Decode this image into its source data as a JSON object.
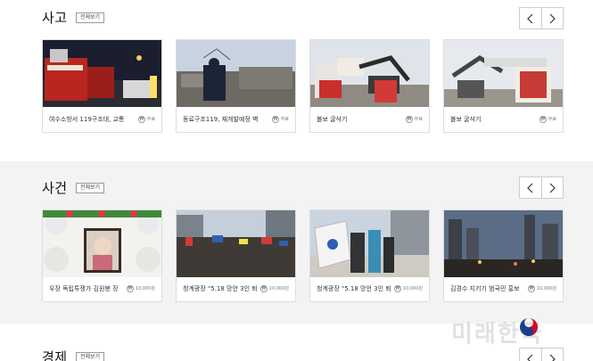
{
  "sections": [
    {
      "title": "사고",
      "more": "전체보기",
      "cards": [
        {
          "title": "여수소방서 119구조대, 교통",
          "price": "무료"
        },
        {
          "title": "동료구조119, 재개발예정 벽",
          "price": "무료"
        },
        {
          "title": "볼보 굴삭기",
          "price": "무료"
        },
        {
          "title": "볼보 굴삭기",
          "price": "무료"
        }
      ]
    },
    {
      "title": "사건",
      "more": "전체보기",
      "cards": [
        {
          "title": "우장 독립투쟁가 김원봉 장",
          "price": "10,000원"
        },
        {
          "title": "청계광장 \"5.18 망언 3인 퇴",
          "price": "10,000원"
        },
        {
          "title": "청계광장 \"5.18 망언 3인 퇴",
          "price": "10,000원"
        },
        {
          "title": "김경수 지키기 범국민 홍보",
          "price": "10,000원"
        }
      ]
    },
    {
      "title": "경제",
      "more": "전체보기"
    }
  ],
  "won_symbol": "₩",
  "watermark": "미래한국"
}
